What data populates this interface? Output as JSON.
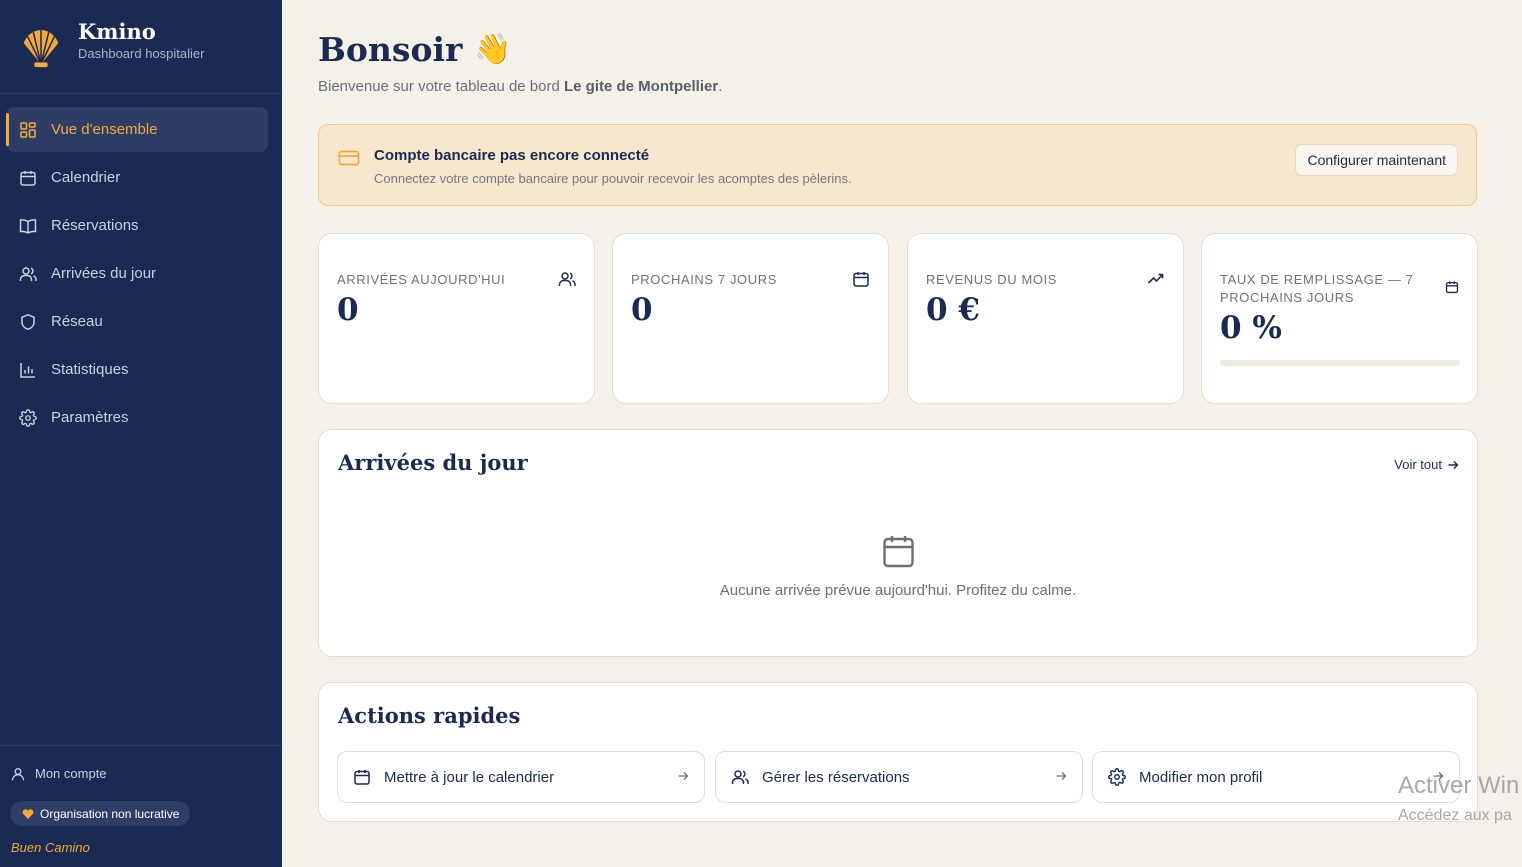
{
  "brand": {
    "name": "Kmino",
    "subtitle": "Dashboard hospitalier"
  },
  "sidebar": {
    "items": [
      {
        "label": "Vue d'ensemble",
        "icon": "grid-icon",
        "active": true
      },
      {
        "label": "Calendrier",
        "icon": "calendar-icon"
      },
      {
        "label": "Réservations",
        "icon": "book-icon"
      },
      {
        "label": "Arrivées du jour",
        "icon": "users-icon"
      },
      {
        "label": "Réseau",
        "icon": "shield-icon"
      },
      {
        "label": "Statistiques",
        "icon": "bar-chart-icon"
      },
      {
        "label": "Paramètres",
        "icon": "gear-icon"
      }
    ],
    "account_label": "Mon compte",
    "org_badge": "Organisation non lucrative",
    "footer_text": "Buen Camino"
  },
  "header": {
    "greeting": "Bonsoir",
    "greeting_emoji": "👋",
    "welcome_prefix": "Bienvenue sur votre tableau de bord ",
    "place_name": "Le gite de Montpellier",
    "welcome_suffix": "."
  },
  "alert": {
    "title": "Compte bancaire pas encore connecté",
    "text": "Connectez votre compte bancaire pour pouvoir recevoir les acomptes des pèlerins.",
    "button": "Configurer maintenant",
    "icon": "credit-card-icon"
  },
  "stats": [
    {
      "label": "ARRIVÉES AUJOURD'HUI",
      "value": "0",
      "icon": "users-icon"
    },
    {
      "label": "PROCHAINS 7 JOURS",
      "value": "0",
      "icon": "calendar-icon"
    },
    {
      "label": "REVENUS DU MOIS",
      "value": "0 €",
      "icon": "trending-up-icon"
    },
    {
      "label": "TAUX DE REMPLISSAGE — 7 PROCHAINS JOURS",
      "value": "0 %",
      "icon": "calendar-icon",
      "progress": 0
    }
  ],
  "arrivals": {
    "title": "Arrivées du jour",
    "see_all": "Voir tout",
    "empty_text": "Aucune arrivée prévue aujourd'hui. Profitez du calme."
  },
  "quick_actions": {
    "title": "Actions rapides",
    "items": [
      {
        "label": "Mettre à jour le calendrier",
        "icon": "calendar-icon"
      },
      {
        "label": "Gérer les réservations",
        "icon": "users-icon"
      },
      {
        "label": "Modifier mon profil",
        "icon": "gear-icon"
      }
    ]
  },
  "os_watermark": {
    "line1": "Activer Win",
    "line2": "Accédez aux pa"
  },
  "colors": {
    "sidebar_bg": "#1b2a52",
    "accent": "#f2a93b",
    "page_bg": "#f5f0e8",
    "alert_bg": "#f8e7cf"
  }
}
